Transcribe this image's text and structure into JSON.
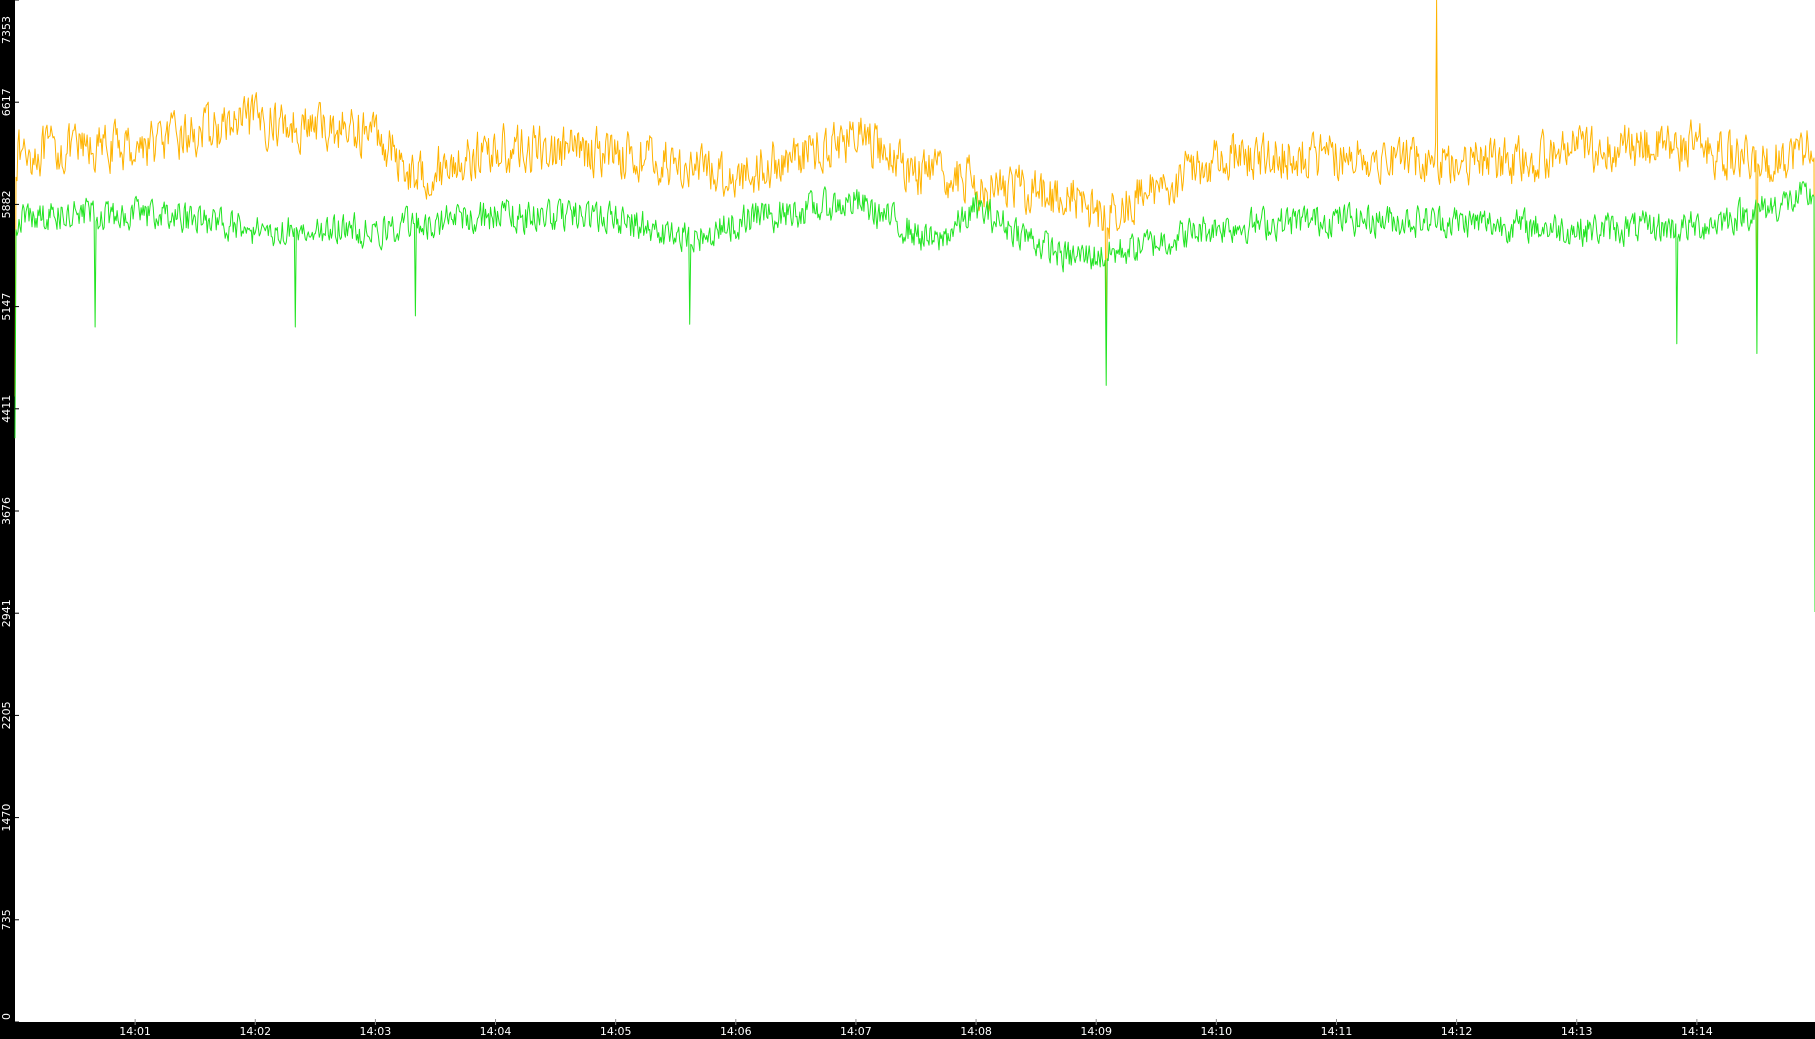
{
  "chart_data": {
    "type": "line",
    "title": "",
    "xlabel": "",
    "ylabel": "",
    "ylim": [
      0,
      7353
    ],
    "y_ticks": [
      "0",
      "735",
      "1470",
      "2205",
      "2941",
      "3676",
      "4411",
      "5147",
      "5882",
      "6617",
      "7353"
    ],
    "x_range": [
      "14:00:00",
      "14:14:59"
    ],
    "x_ticks": [
      "14:01",
      "14:02",
      "14:03",
      "14:04",
      "14:05",
      "14:06",
      "14:07",
      "14:08",
      "14:09",
      "14:10",
      "14:11",
      "14:12",
      "14:13",
      "14:14"
    ],
    "grid": false,
    "legend": "none",
    "background": "#ffffff",
    "axis_color": "#000000",
    "series": [
      {
        "color": "#ffb300",
        "sample_interval_s": 0.5,
        "mean": 6250,
        "noise": 230,
        "baseline": [
          {
            "t": "14:00:00",
            "v": 6250
          },
          {
            "t": "14:01:00",
            "v": 6300
          },
          {
            "t": "14:02:00",
            "v": 6480
          },
          {
            "t": "14:03:00",
            "v": 6400
          },
          {
            "t": "14:03:20",
            "v": 6080
          },
          {
            "t": "14:04:00",
            "v": 6280
          },
          {
            "t": "14:05:00",
            "v": 6260
          },
          {
            "t": "14:06:00",
            "v": 6080
          },
          {
            "t": "14:07:00",
            "v": 6380
          },
          {
            "t": "14:07:30",
            "v": 6120
          },
          {
            "t": "14:08:00",
            "v": 6040
          },
          {
            "t": "14:08:45",
            "v": 5940
          },
          {
            "t": "14:09:05",
            "v": 5800
          },
          {
            "t": "14:10:00",
            "v": 6220
          },
          {
            "t": "14:11:00",
            "v": 6230
          },
          {
            "t": "14:12:00",
            "v": 6200
          },
          {
            "t": "14:12:30",
            "v": 6180
          },
          {
            "t": "14:13:00",
            "v": 6280
          },
          {
            "t": "14:14:00",
            "v": 6300
          },
          {
            "t": "14:14:30",
            "v": 6160
          },
          {
            "t": "14:14:59",
            "v": 6320
          }
        ],
        "spikes": [
          {
            "t": "14:09:05",
            "v": 4900
          },
          {
            "t": "14:11:50",
            "v": 7353
          },
          {
            "t": "14:14:30",
            "v": 5080
          },
          {
            "t": "14:00:00",
            "v": 4500
          },
          {
            "t": "14:14:59",
            "v": 3200
          }
        ]
      },
      {
        "color": "#22e422",
        "sample_interval_s": 0.5,
        "mean": 5750,
        "noise": 160,
        "baseline": [
          {
            "t": "14:00:00",
            "v": 5780
          },
          {
            "t": "14:01:00",
            "v": 5830
          },
          {
            "t": "14:02:00",
            "v": 5700
          },
          {
            "t": "14:03:00",
            "v": 5700
          },
          {
            "t": "14:04:00",
            "v": 5800
          },
          {
            "t": "14:05:00",
            "v": 5780
          },
          {
            "t": "14:05:40",
            "v": 5620
          },
          {
            "t": "14:06:00",
            "v": 5760
          },
          {
            "t": "14:07:00",
            "v": 5900
          },
          {
            "t": "14:07:40",
            "v": 5600
          },
          {
            "t": "14:08:00",
            "v": 5850
          },
          {
            "t": "14:08:45",
            "v": 5500
          },
          {
            "t": "14:09:05",
            "v": 5520
          },
          {
            "t": "14:10:00",
            "v": 5720
          },
          {
            "t": "14:11:00",
            "v": 5780
          },
          {
            "t": "14:12:00",
            "v": 5760
          },
          {
            "t": "14:13:00",
            "v": 5700
          },
          {
            "t": "14:14:00",
            "v": 5720
          },
          {
            "t": "14:14:59",
            "v": 5950
          }
        ],
        "spikes": [
          {
            "t": "14:00:40",
            "v": 5000
          },
          {
            "t": "14:02:20",
            "v": 5000
          },
          {
            "t": "14:03:20",
            "v": 5080
          },
          {
            "t": "14:05:37",
            "v": 5020
          },
          {
            "t": "14:09:05",
            "v": 4580
          },
          {
            "t": "14:13:50",
            "v": 4880
          },
          {
            "t": "14:14:30",
            "v": 4810
          },
          {
            "t": "14:00:00",
            "v": 4200
          },
          {
            "t": "14:14:59",
            "v": 2950
          }
        ]
      }
    ]
  }
}
